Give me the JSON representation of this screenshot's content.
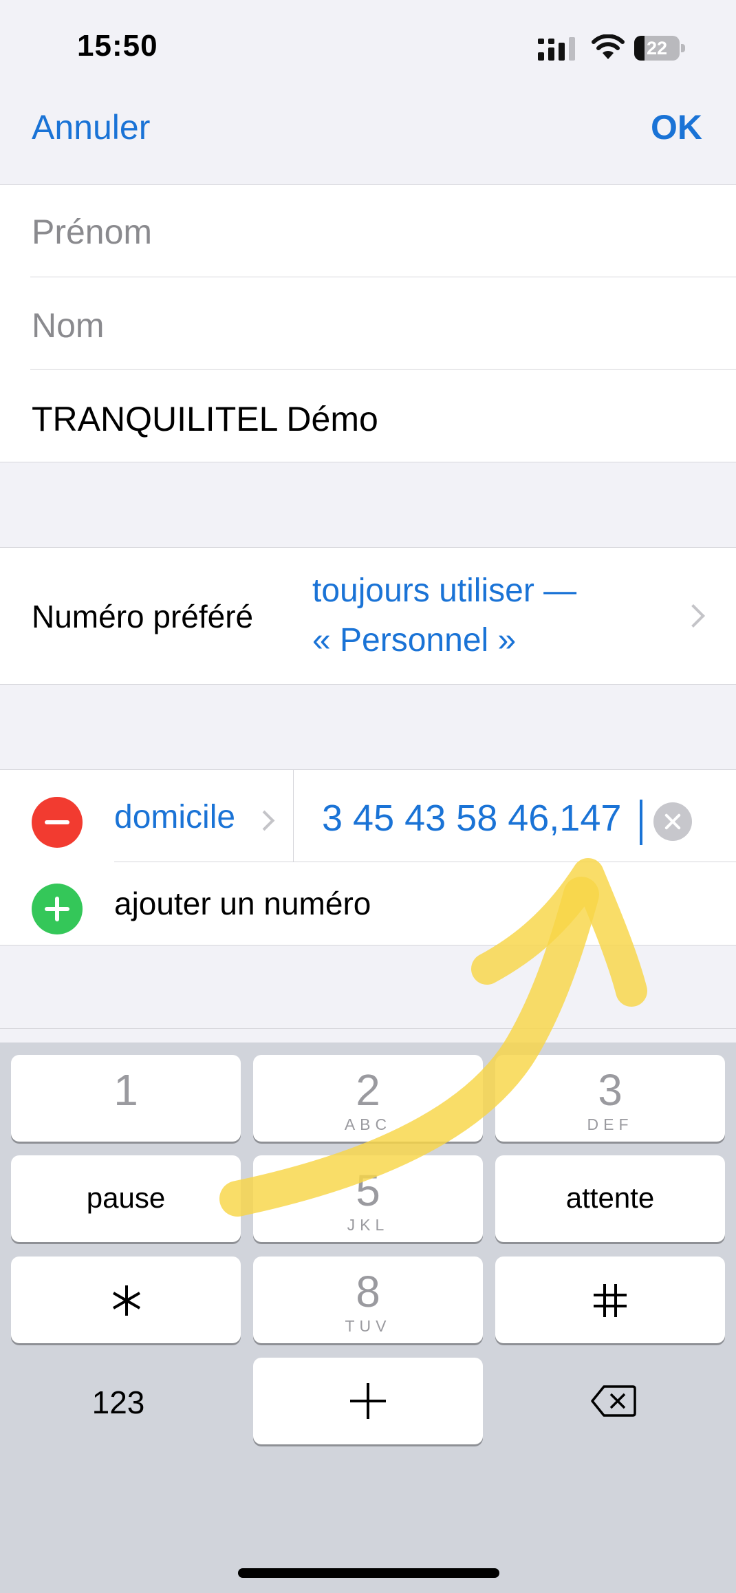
{
  "status_bar": {
    "time": "15:50",
    "battery_level": "22",
    "battery_fraction": 0.22,
    "icons": [
      "signal-icon",
      "wifi-icon",
      "battery-icon"
    ]
  },
  "nav": {
    "cancel_label": "Annuler",
    "done_label": "OK"
  },
  "name_section": {
    "first_name_placeholder": "Prénom",
    "last_name_placeholder": "Nom",
    "company_value": "TRANQUILITEL Démo"
  },
  "preferred_number": {
    "label": "Numéro préféré",
    "value_line1": "toujours utiliser —",
    "value_line2": "« Personnel »"
  },
  "phone_section": {
    "phone_label": "domicile",
    "phone_value": "3 45 43 58 46,147",
    "add_label": "ajouter un numéro"
  },
  "keypad": {
    "keys": [
      {
        "main": "1",
        "letters": ""
      },
      {
        "main": "2",
        "letters": "ABC"
      },
      {
        "main": "3",
        "letters": "DEF"
      },
      {
        "main": "pause",
        "letters": ""
      },
      {
        "main": "5",
        "letters": "JKL"
      },
      {
        "main": "attente",
        "letters": ""
      },
      {
        "main": "*",
        "letters": ""
      },
      {
        "main": "8",
        "letters": "TUV"
      },
      {
        "main": "#",
        "letters": ""
      },
      {
        "main": "123",
        "letters": ""
      },
      {
        "main": "+",
        "letters": ""
      },
      {
        "main": "",
        "letters": ""
      }
    ]
  },
  "colors": {
    "accent": "#1a73d6",
    "delete_red": "#f23b30",
    "add_green": "#34c759",
    "highlight_yellow": "#f8d547"
  }
}
